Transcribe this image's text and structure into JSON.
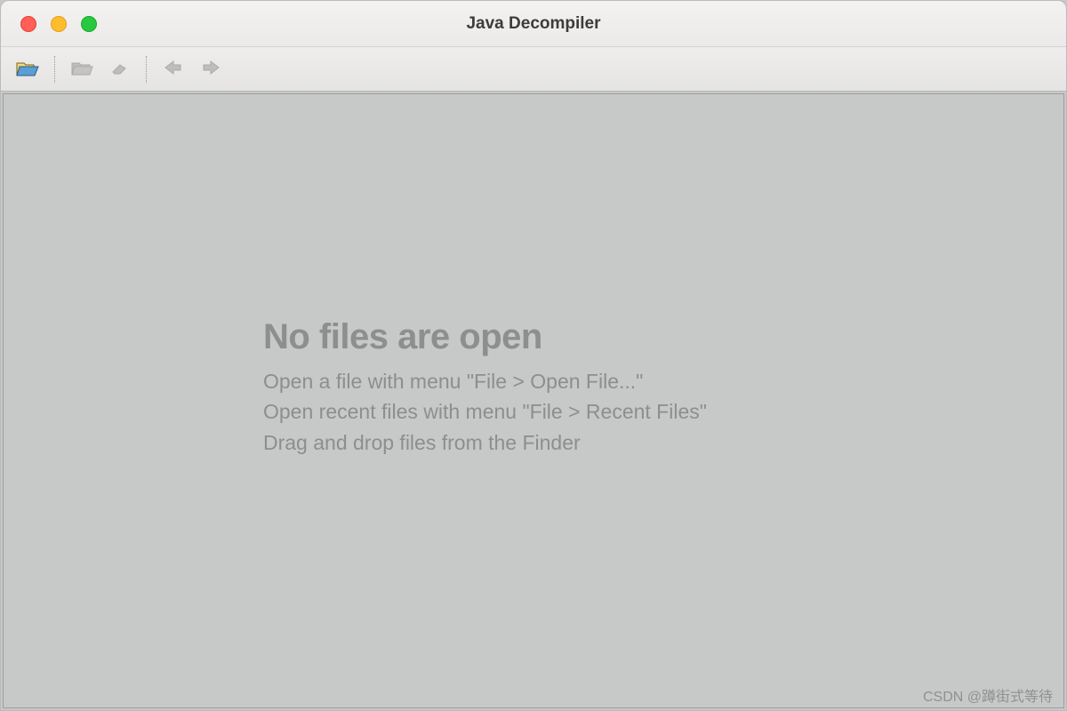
{
  "window": {
    "title": "Java Decompiler"
  },
  "toolbar": {
    "open_icon": "open-folder-icon",
    "folder_icon": "folder-icon",
    "eraser_icon": "eraser-icon",
    "back_icon": "arrow-left-icon",
    "forward_icon": "arrow-right-icon"
  },
  "empty_state": {
    "heading": "No files are open",
    "hint1": "Open a file with menu \"File > Open File...\"",
    "hint2": "Open recent files with menu \"File > Recent Files\"",
    "hint3": "Drag and drop files from the Finder"
  },
  "watermark": "CSDN @蹲街式等待"
}
